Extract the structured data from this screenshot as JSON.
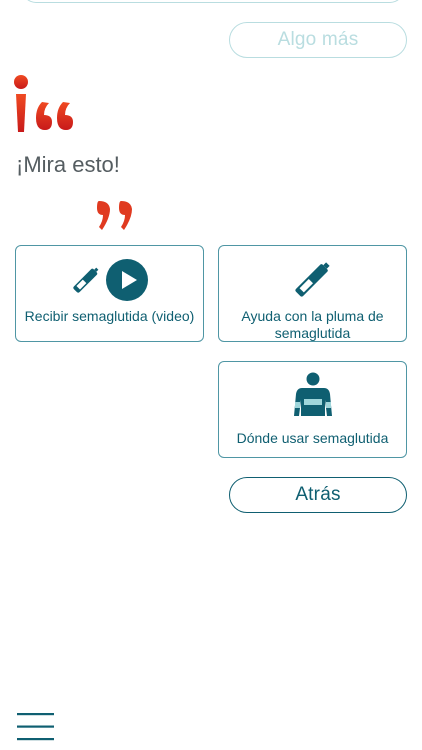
{
  "header": {
    "more_button_label": "Algo más"
  },
  "tip": {
    "text": "¡Mira esto!"
  },
  "cards": [
    {
      "label": "Recibir semaglutida (video)",
      "icons": [
        "pen-icon",
        "play-icon"
      ]
    },
    {
      "label": "Ayuda con la pluma de semaglutida",
      "icons": [
        "pen-icon"
      ]
    },
    {
      "label": "Dónde usar semaglutida",
      "icons": [
        "body-icon"
      ]
    }
  ],
  "footer": {
    "back_button_label": "Atrás"
  },
  "colors": {
    "accent": "#0f5f71",
    "accent_light": "#b9dde0",
    "quote_red": "#d9261c",
    "text_gray": "#555d61"
  },
  "icons": {
    "quote_open": "exclamation-quote-icon",
    "quote_close": "close-quote-icon",
    "menu": "hamburger-menu-icon"
  }
}
